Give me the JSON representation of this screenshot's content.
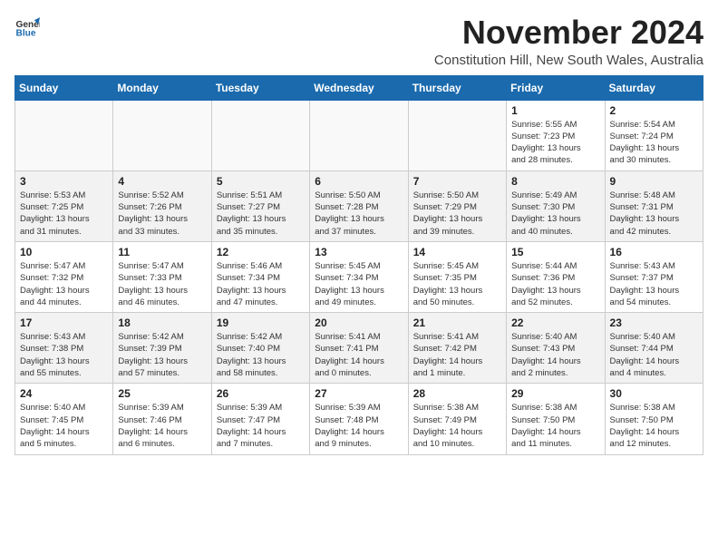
{
  "logo": {
    "general": "General",
    "blue": "Blue"
  },
  "title": "November 2024",
  "subtitle": "Constitution Hill, New South Wales, Australia",
  "weekdays": [
    "Sunday",
    "Monday",
    "Tuesday",
    "Wednesday",
    "Thursday",
    "Friday",
    "Saturday"
  ],
  "weeks": [
    [
      {
        "day": "",
        "info": ""
      },
      {
        "day": "",
        "info": ""
      },
      {
        "day": "",
        "info": ""
      },
      {
        "day": "",
        "info": ""
      },
      {
        "day": "",
        "info": ""
      },
      {
        "day": "1",
        "info": "Sunrise: 5:55 AM\nSunset: 7:23 PM\nDaylight: 13 hours\nand 28 minutes."
      },
      {
        "day": "2",
        "info": "Sunrise: 5:54 AM\nSunset: 7:24 PM\nDaylight: 13 hours\nand 30 minutes."
      }
    ],
    [
      {
        "day": "3",
        "info": "Sunrise: 5:53 AM\nSunset: 7:25 PM\nDaylight: 13 hours\nand 31 minutes."
      },
      {
        "day": "4",
        "info": "Sunrise: 5:52 AM\nSunset: 7:26 PM\nDaylight: 13 hours\nand 33 minutes."
      },
      {
        "day": "5",
        "info": "Sunrise: 5:51 AM\nSunset: 7:27 PM\nDaylight: 13 hours\nand 35 minutes."
      },
      {
        "day": "6",
        "info": "Sunrise: 5:50 AM\nSunset: 7:28 PM\nDaylight: 13 hours\nand 37 minutes."
      },
      {
        "day": "7",
        "info": "Sunrise: 5:50 AM\nSunset: 7:29 PM\nDaylight: 13 hours\nand 39 minutes."
      },
      {
        "day": "8",
        "info": "Sunrise: 5:49 AM\nSunset: 7:30 PM\nDaylight: 13 hours\nand 40 minutes."
      },
      {
        "day": "9",
        "info": "Sunrise: 5:48 AM\nSunset: 7:31 PM\nDaylight: 13 hours\nand 42 minutes."
      }
    ],
    [
      {
        "day": "10",
        "info": "Sunrise: 5:47 AM\nSunset: 7:32 PM\nDaylight: 13 hours\nand 44 minutes."
      },
      {
        "day": "11",
        "info": "Sunrise: 5:47 AM\nSunset: 7:33 PM\nDaylight: 13 hours\nand 46 minutes."
      },
      {
        "day": "12",
        "info": "Sunrise: 5:46 AM\nSunset: 7:34 PM\nDaylight: 13 hours\nand 47 minutes."
      },
      {
        "day": "13",
        "info": "Sunrise: 5:45 AM\nSunset: 7:34 PM\nDaylight: 13 hours\nand 49 minutes."
      },
      {
        "day": "14",
        "info": "Sunrise: 5:45 AM\nSunset: 7:35 PM\nDaylight: 13 hours\nand 50 minutes."
      },
      {
        "day": "15",
        "info": "Sunrise: 5:44 AM\nSunset: 7:36 PM\nDaylight: 13 hours\nand 52 minutes."
      },
      {
        "day": "16",
        "info": "Sunrise: 5:43 AM\nSunset: 7:37 PM\nDaylight: 13 hours\nand 54 minutes."
      }
    ],
    [
      {
        "day": "17",
        "info": "Sunrise: 5:43 AM\nSunset: 7:38 PM\nDaylight: 13 hours\nand 55 minutes."
      },
      {
        "day": "18",
        "info": "Sunrise: 5:42 AM\nSunset: 7:39 PM\nDaylight: 13 hours\nand 57 minutes."
      },
      {
        "day": "19",
        "info": "Sunrise: 5:42 AM\nSunset: 7:40 PM\nDaylight: 13 hours\nand 58 minutes."
      },
      {
        "day": "20",
        "info": "Sunrise: 5:41 AM\nSunset: 7:41 PM\nDaylight: 14 hours\nand 0 minutes."
      },
      {
        "day": "21",
        "info": "Sunrise: 5:41 AM\nSunset: 7:42 PM\nDaylight: 14 hours\nand 1 minute."
      },
      {
        "day": "22",
        "info": "Sunrise: 5:40 AM\nSunset: 7:43 PM\nDaylight: 14 hours\nand 2 minutes."
      },
      {
        "day": "23",
        "info": "Sunrise: 5:40 AM\nSunset: 7:44 PM\nDaylight: 14 hours\nand 4 minutes."
      }
    ],
    [
      {
        "day": "24",
        "info": "Sunrise: 5:40 AM\nSunset: 7:45 PM\nDaylight: 14 hours\nand 5 minutes."
      },
      {
        "day": "25",
        "info": "Sunrise: 5:39 AM\nSunset: 7:46 PM\nDaylight: 14 hours\nand 6 minutes."
      },
      {
        "day": "26",
        "info": "Sunrise: 5:39 AM\nSunset: 7:47 PM\nDaylight: 14 hours\nand 7 minutes."
      },
      {
        "day": "27",
        "info": "Sunrise: 5:39 AM\nSunset: 7:48 PM\nDaylight: 14 hours\nand 9 minutes."
      },
      {
        "day": "28",
        "info": "Sunrise: 5:38 AM\nSunset: 7:49 PM\nDaylight: 14 hours\nand 10 minutes."
      },
      {
        "day": "29",
        "info": "Sunrise: 5:38 AM\nSunset: 7:50 PM\nDaylight: 14 hours\nand 11 minutes."
      },
      {
        "day": "30",
        "info": "Sunrise: 5:38 AM\nSunset: 7:50 PM\nDaylight: 14 hours\nand 12 minutes."
      }
    ]
  ]
}
